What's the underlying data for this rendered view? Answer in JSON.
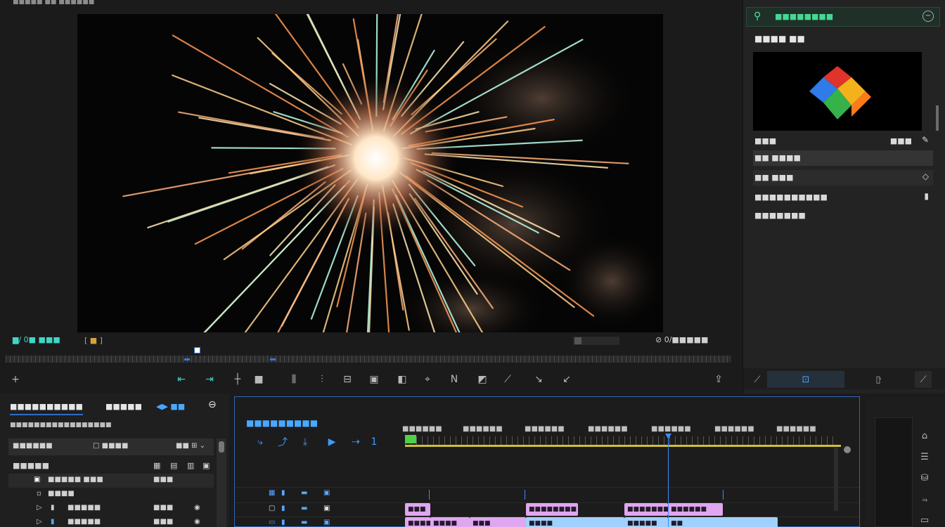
{
  "app": {
    "top_label": "■■■■■ ■■ ■■■■■■"
  },
  "viewer": {
    "timecode": "▆/ 0■ ■■■",
    "badge": "[ ■ ]",
    "zoom_label": "⊘ 0/■■■■■",
    "colors": {
      "accent": "#3fd6c7",
      "badge": "#d8a23c"
    }
  },
  "toolbar": {
    "add": "+",
    "tools": [
      "⇤",
      "⇥",
      "┼",
      "■",
      "⫼",
      "⫶",
      "⊟",
      "▣",
      "◧",
      "⌖",
      "N",
      "◩",
      "⟋",
      "↘",
      "↙"
    ],
    "export": "⇪"
  },
  "inspector": {
    "search_placeholder": "■■■■■■■■",
    "search_icon": "search-icon",
    "close_icon": "close-circle-icon",
    "title": "■■■■ ■■",
    "rows": [
      {
        "label": "■■■",
        "value": "■■■",
        "icon": "✎"
      },
      {
        "label": "■■ ■■■■"
      },
      {
        "label": "■■ ■■■",
        "icon": "◇"
      },
      {
        "label": "■■■■■■■■■■",
        "icon": "▮"
      },
      {
        "label": "■■■■■■■"
      }
    ],
    "bottom_icons": [
      "⟋",
      "⊡",
      "·",
      "▯",
      "⟋"
    ]
  },
  "project": {
    "tab_active": "■■■■■■■■■■",
    "tab_2": "■■■■■",
    "tab_3": "◀▶ ■■",
    "settings_icon": "⊖",
    "subtitle": "■■■■■■■■■■■■■■■■■",
    "search_left": "■■■■■■",
    "search_mid": "□ ■■■■",
    "search_right": "■■ ⊞ ⌄",
    "list_head": "■■■■■",
    "head_icons": [
      "▦",
      "▤",
      "▥",
      "▣"
    ],
    "items": [
      {
        "name": "■■■■■ ■■■",
        "meta": "■■■",
        "icon": "▲"
      },
      {
        "name": "■■■■",
        "meta": "",
        "icon": ""
      },
      {
        "name": "■■■■■",
        "meta": "■■■",
        "icon": "◉"
      },
      {
        "name": "■■■■■",
        "meta": "■■■",
        "icon": "◉"
      }
    ]
  },
  "timeline": {
    "title": "■■■■■■■■■",
    "tools": [
      "⤷",
      "⤴",
      "⤓",
      "▶",
      "⇢",
      "1"
    ],
    "ruler_labels": [
      "■■■■■■",
      "■■■■■■",
      "■■■■■■",
      "■■■■■■",
      "■■■■■■",
      "■■■■■■",
      "■■■■■■"
    ],
    "track_headers": [
      {
        "a": "▦",
        "b": "▮",
        "c": "▬",
        "d": "▣"
      },
      {
        "a": "▢",
        "b": "▮",
        "c": "▬",
        "d": "▣"
      },
      {
        "a": "▭",
        "b": "▮",
        "c": "▬",
        "d": "▣"
      }
    ],
    "clips_row1": [
      "■■■",
      "■■■■■■■■",
      "■■■■■■■",
      "■■■■■■"
    ],
    "clips_row2": [
      "■■■■",
      "■■■■",
      "■■■",
      "■■■■",
      "■■■■■",
      "■■"
    ],
    "colors": {
      "playhead": "#3b8cff",
      "workarea": "#cdbf3a",
      "clip_pink": "#e0a6f0",
      "clip_blue": "#9fd0ff"
    }
  },
  "right_strip": {
    "icons": [
      "⌂",
      "☰",
      "⛁",
      "⫬",
      "▭"
    ]
  }
}
